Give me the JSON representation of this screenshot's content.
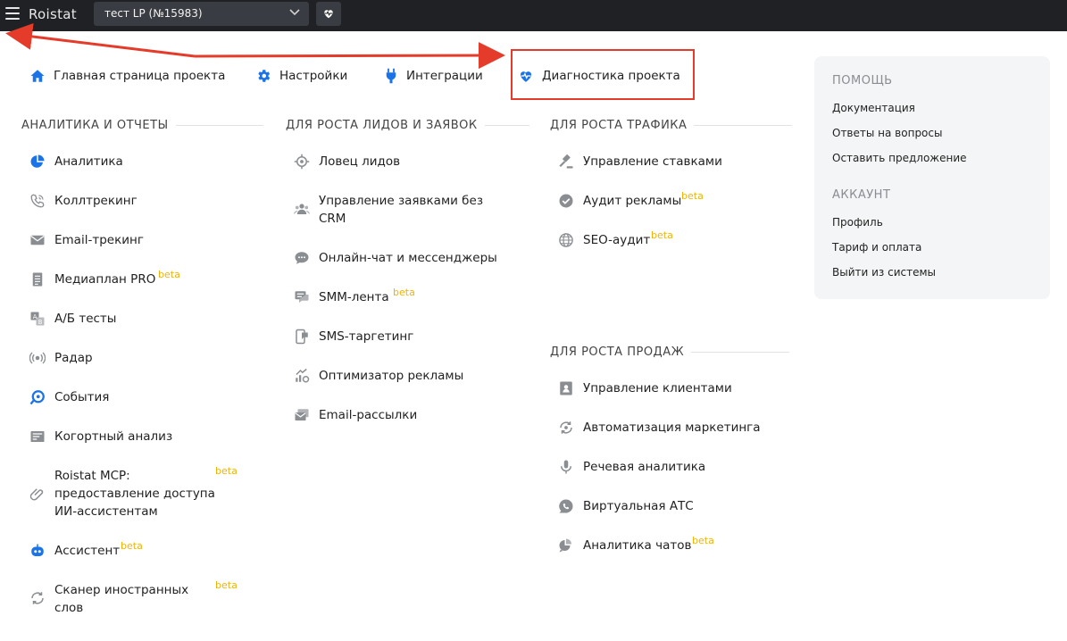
{
  "topbar": {
    "logo": "Roistat",
    "project": "тест LP (№15983)"
  },
  "top_links": {
    "home": "Главная страница проекта",
    "settings": "Настройки",
    "integrations": "Интеграции",
    "diagnostics": "Диагностика проекта"
  },
  "sections": {
    "analytics": {
      "title": "АНАЛИТИКА И ОТЧЕТЫ",
      "items": [
        {
          "label": "Аналитика"
        },
        {
          "label": "Коллтрекинг"
        },
        {
          "label": "Email-трекинг"
        },
        {
          "label": "Медиаплан PRO",
          "badge": "beta"
        },
        {
          "label": "А/Б тесты"
        },
        {
          "label": "Радар"
        },
        {
          "label": "События"
        },
        {
          "label": "Когортный анализ"
        },
        {
          "label": "Roistat MCP:",
          "line2": "предоставление доступа",
          "line3": "ИИ-ассистентам",
          "badge": "beta"
        },
        {
          "label": "Ассистент",
          "badge": "beta"
        },
        {
          "label": "Сканер иностранных",
          "line2": "слов",
          "badge": "beta"
        }
      ]
    },
    "leads": {
      "title": "ДЛЯ РОСТА ЛИДОВ И ЗАЯВОК",
      "items": [
        {
          "label": "Ловец лидов"
        },
        {
          "label": "Управление заявками без",
          "line2": "CRM"
        },
        {
          "label": "Онлайн-чат и мессенджеры"
        },
        {
          "label": "SMM-лента",
          "badge": "beta"
        },
        {
          "label": "SMS-таргетинг"
        },
        {
          "label": "Оптимизатор рекламы"
        },
        {
          "label": "Email-рассылки"
        }
      ]
    },
    "traffic": {
      "title": "ДЛЯ РОСТА ТРАФИКА",
      "items": [
        {
          "label": "Управление ставками"
        },
        {
          "label": "Аудит рекламы",
          "badge": "beta"
        },
        {
          "label": "SEO-аудит",
          "badge": "beta"
        }
      ]
    },
    "sales": {
      "title": "ДЛЯ РОСТА ПРОДАЖ",
      "items": [
        {
          "label": "Управление клиентами"
        },
        {
          "label": "Автоматизация маркетинга"
        },
        {
          "label": "Речевая аналитика"
        },
        {
          "label": "Виртуальная АТС"
        },
        {
          "label": "Аналитика чатов",
          "badge": "beta"
        }
      ]
    }
  },
  "help": {
    "title": "ПОМОЩЬ",
    "links": [
      "Документация",
      "Ответы на вопросы",
      "Оставить предложение"
    ],
    "account_title": "АККАУНТ",
    "account_links": [
      "Профиль",
      "Тариф и оплата",
      "Выйти из системы"
    ]
  },
  "colors": {
    "accent": "#1a73e8",
    "beta": "#f0b400",
    "highlight": "#e53b2a",
    "topbar": "#1f2124"
  }
}
